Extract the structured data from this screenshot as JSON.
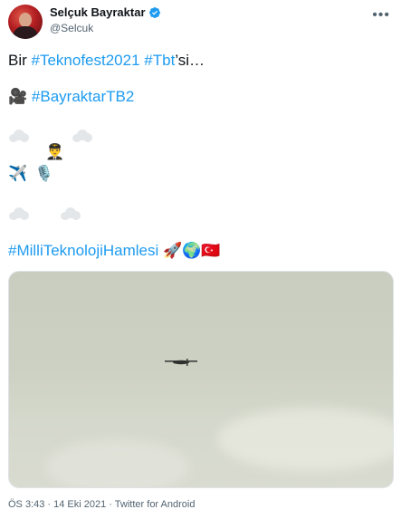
{
  "author": {
    "name": "Selçuk Bayraktar",
    "handle": "@Selcuk"
  },
  "tweet": {
    "line1_prefix": "Bir ",
    "hashtag1": "#Teknofest2021",
    "space": " ",
    "hashtag2": "#Tbt",
    "line1_suffix": "’si…",
    "camera_emoji": "🎥",
    "hashtag3": "#BayraktarTB2",
    "pilot_emoji": "👨‍✈️",
    "plane_emoji": "✈️",
    "mic_emoji": "🎙️",
    "hashtag4": "#MilliTeknolojiHamlesi",
    "rocket_emoji": "🚀",
    "globe_emoji": "🌍",
    "flag_emoji": "🇹🇷"
  },
  "footer": {
    "meta": "ÖS 3:43 · 14 Eki 2021 · Twitter for Android"
  },
  "colors": {
    "accent": "#1d9bf0",
    "secondary_text": "#536471",
    "flag_red": "#e30a17"
  },
  "icons": [
    "verified-badge-icon",
    "more-options-icon",
    "cloud-icon"
  ]
}
